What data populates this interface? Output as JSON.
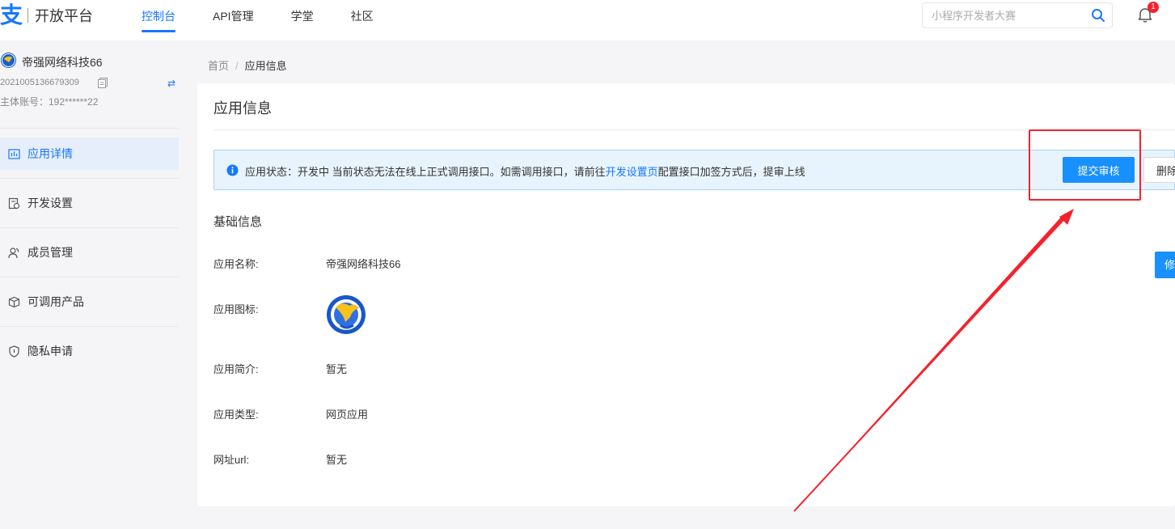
{
  "header": {
    "logo_mark": "支",
    "logo_text": "开放平台",
    "nav": [
      {
        "label": "控制台",
        "active": true
      },
      {
        "label": "API管理",
        "active": false
      },
      {
        "label": "学堂",
        "active": false
      },
      {
        "label": "社区",
        "active": false
      }
    ],
    "search_placeholder": "小程序开发者大赛",
    "notification_count": "1"
  },
  "sidebar": {
    "account_name": "帝强网络科技66",
    "account_id": "2021005136679309",
    "main_account": "主体账号：192******22",
    "items": [
      {
        "label": "应用详情",
        "icon": "chart-icon",
        "active": true
      },
      {
        "label": "开发设置",
        "icon": "settings-doc-icon",
        "active": false
      },
      {
        "label": "成员管理",
        "icon": "members-icon",
        "active": false
      },
      {
        "label": "可调用产品",
        "icon": "product-icon",
        "active": false
      },
      {
        "label": "隐私申请",
        "icon": "shield-icon",
        "active": false
      }
    ]
  },
  "breadcrumb": {
    "home": "首页",
    "separator": "/",
    "current": "应用信息"
  },
  "card": {
    "title": "应用信息",
    "alert": {
      "prefix": "应用状态：开发中 当前状态无法在线上正式调用接口。如需调用接口，请前往",
      "link": "开发设置页",
      "suffix": "配置接口加签方式后，提审上线"
    },
    "submit_label": "提交审核",
    "delete_label": "删除",
    "edit_label": "修改",
    "section_title": "基础信息",
    "fields": [
      {
        "label": "应用名称:",
        "value": "帝强网络科技66"
      },
      {
        "label": "应用图标:",
        "value": ""
      },
      {
        "label": "应用简介:",
        "value": "暂无"
      },
      {
        "label": "应用类型:",
        "value": "网页应用"
      },
      {
        "label": "网址url:",
        "value": "暂无"
      }
    ]
  },
  "colors": {
    "primary": "#1677ff",
    "button_blue": "#1890ff",
    "annotation_red": "#f5222d",
    "alert_bg": "#e8f4fd"
  }
}
